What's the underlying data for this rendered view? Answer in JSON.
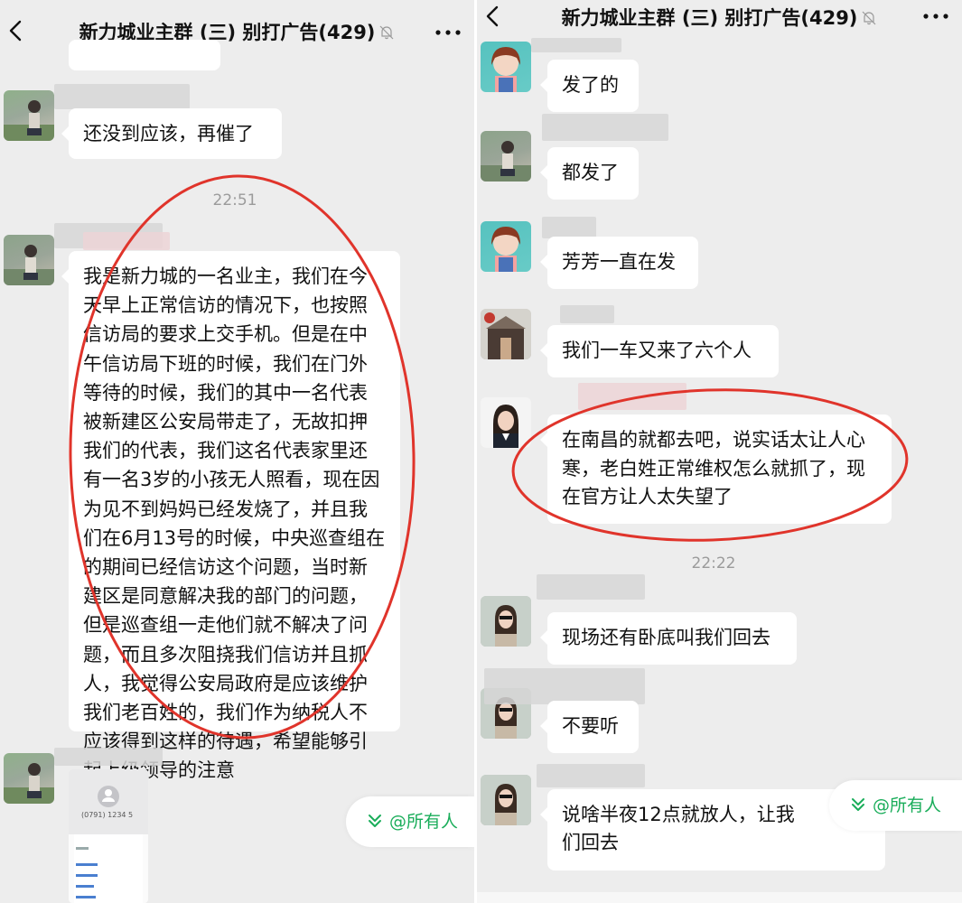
{
  "chat": {
    "title": "新力城业主群 (三) 别打广告(429)"
  },
  "left": {
    "msg1": "还没到应该，再催了",
    "time1": "22:51",
    "msg2": "我是新力城的一名业主，我们在今天早上正常信访的情况下，也按照信访局的要求上交手机。但是在中午信访局下班的时候，我们在门外等待的时候，我们的其中一名代表被新建区公安局带走了，无故扣押我们的代表，我们这名代表家里还有一名3岁的小孩无人照看，现在因为见不到妈妈已经发烧了，并且我们在6月13号的时候，中央巡查组在的期间已经信访这个问题，当时新建区是同意解决我的部门的问题，但是巡查组一走他们就不解决了问题，而且多次阻挠我们信访并且抓人，我觉得公安局政府是应该维护我们老百姓的，我们作为纳税人不应该得到这样的待遇，希望能够引起上级领导的注意",
    "image_phone_number": "(0791) 1234 5",
    "at_all": "@所有人"
  },
  "right": {
    "msg1": "发了的",
    "msg2": "都发了",
    "msg3": "芳芳一直在发",
    "msg4": "我们一车又来了六个人",
    "msg5": "在南昌的就都去吧，说实话太让人心寒，老白姓正常维权怎么就抓了，现在官方让人太失望了",
    "time1": "22:22",
    "msg6": "现场还有卧底叫我们回去",
    "msg7": "不要听",
    "msg8": "说啥半夜12点就放人，让我们回去",
    "at_all": "@所有人"
  },
  "colors": {
    "chat_bg": "#ededed",
    "bubble_bg": "#ffffff",
    "annotation_red": "#e0342b",
    "accent_green": "#1aad5a",
    "time_gray": "#9b9b9b"
  },
  "icons": [
    "back-chevron-icon",
    "mute-bell-icon",
    "more-dots-icon",
    "double-chevron-down-icon"
  ]
}
